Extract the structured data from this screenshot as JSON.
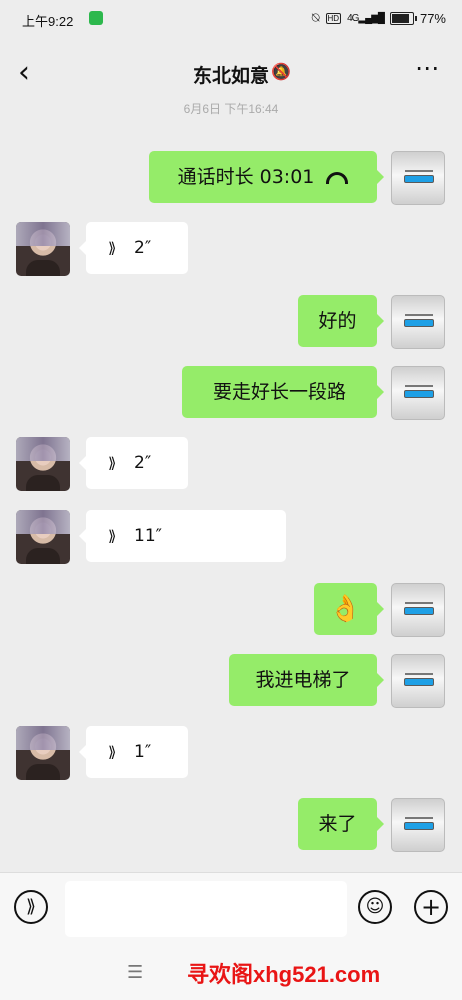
{
  "status": {
    "time": "上午9:22",
    "battery_text": "77%",
    "battery_level": 0.77,
    "icons": [
      "wechat-icon",
      "alarm-off-icon",
      "hd-icon",
      "4g-signal-icon",
      "battery-icon"
    ]
  },
  "header": {
    "title": "东北如意",
    "back_icon": "chevron-left-icon",
    "mute_icon": "bell-off-icon",
    "more_icon": "more-icon"
  },
  "timestamp": "6月6日 下午16:44",
  "messages": [
    {
      "from": "me",
      "text": "通话时长 03:01",
      "icon": "phone-hangup-icon"
    },
    {
      "from": "other",
      "type": "voice",
      "duration": "2″"
    },
    {
      "from": "me",
      "text": "好的"
    },
    {
      "from": "me",
      "text": "要走好长一段路"
    },
    {
      "from": "other",
      "type": "voice",
      "duration": "2″"
    },
    {
      "from": "other",
      "type": "voice",
      "duration": "11″"
    },
    {
      "from": "me",
      "text": "👌"
    },
    {
      "from": "me",
      "text": "我进电梯了"
    },
    {
      "from": "other",
      "type": "voice",
      "duration": "1″"
    },
    {
      "from": "me",
      "text": "来了"
    }
  ],
  "input_bar": {
    "voice_icon": "voice-input-icon",
    "emoji_icon": "emoji-icon",
    "plus_icon": "plus-icon",
    "placeholder": ""
  },
  "nav": {
    "menu_icon": "menu-icon",
    "watermark": "寻欢阁xhg521.com"
  }
}
